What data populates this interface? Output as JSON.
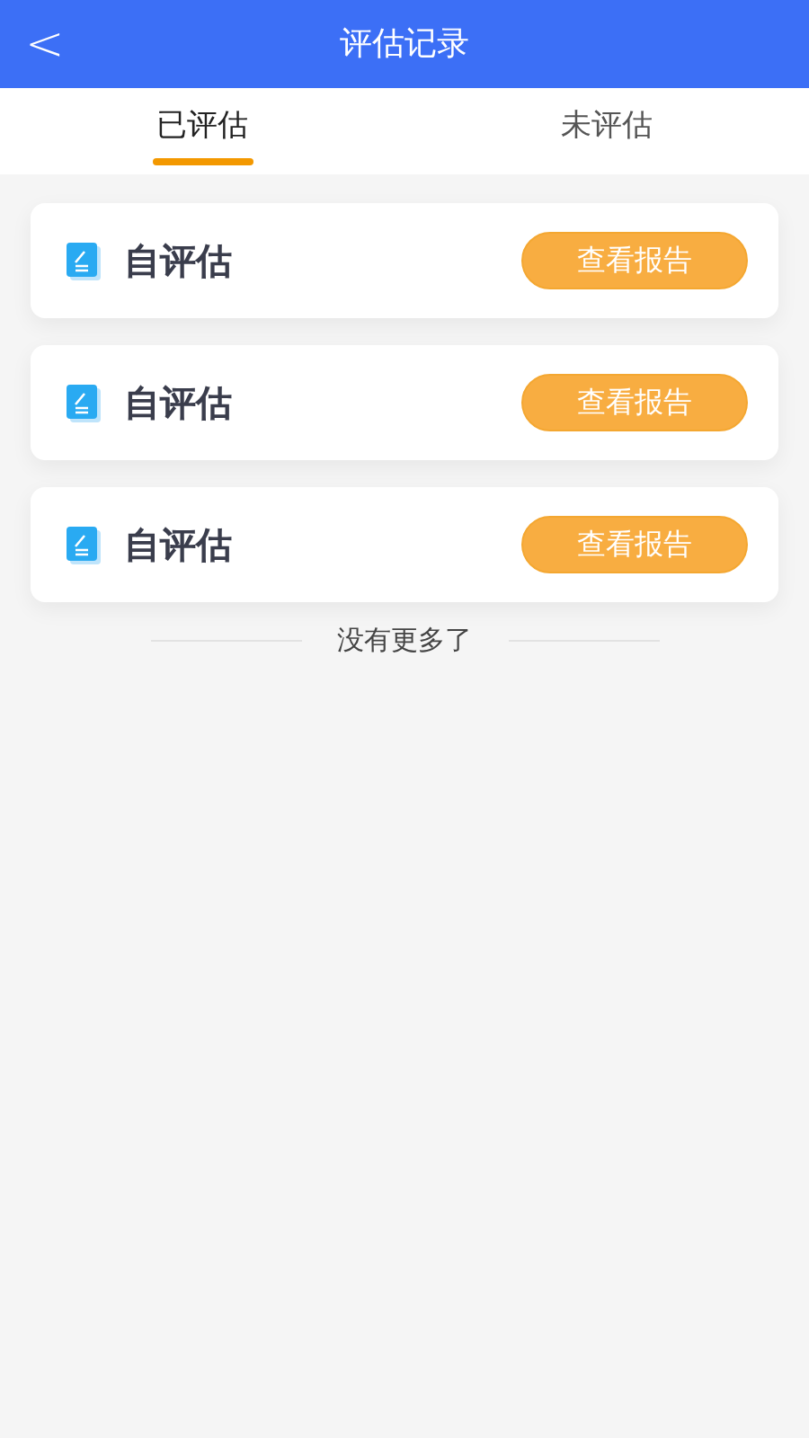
{
  "header": {
    "back": "<",
    "title": "评估记录"
  },
  "tabs": [
    {
      "label": "已评估",
      "selected": true
    },
    {
      "label": "未评估",
      "selected": false
    }
  ],
  "records": [
    {
      "title": "自评估",
      "button": "查看报告"
    },
    {
      "title": "自评估",
      "button": "查看报告"
    },
    {
      "title": "自评估",
      "button": "查看报告"
    }
  ],
  "end_note": "没有更多了"
}
